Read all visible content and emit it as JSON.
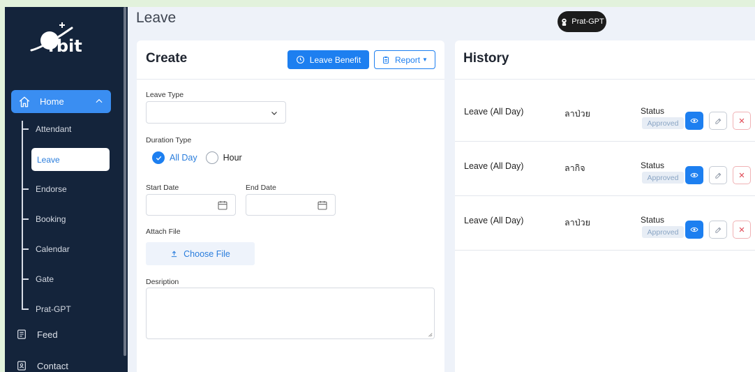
{
  "sidebar": {
    "brand": "rbit",
    "home_label": "Home",
    "sub_items": [
      {
        "label": "Attendant"
      },
      {
        "label": "Leave"
      },
      {
        "label": "Endorse"
      },
      {
        "label": "Booking"
      },
      {
        "label": "Calendar"
      },
      {
        "label": "Gate"
      },
      {
        "label": "Prat-GPT"
      }
    ],
    "feed_label": "Feed",
    "contact_label": "Contact"
  },
  "header": {
    "page_title": "Leave",
    "gpt_badge": "Prat-GPT"
  },
  "create": {
    "title": "Create",
    "benefit_button": "Leave Benefit",
    "report_button": "Report",
    "leave_type_label": "Leave Type",
    "duration_type_label": "Duration Type",
    "duration_options": [
      "All Day",
      "Hour"
    ],
    "duration_selected": "All Day",
    "start_date_label": "Start Date",
    "end_date_label": "End Date",
    "attach_label": "Attach File",
    "choose_file": "Choose File",
    "description_label": "Desription"
  },
  "history": {
    "title": "History",
    "rows": [
      {
        "type": "Leave (All Day)",
        "reason": "ลาป่วย",
        "status_label": "Status",
        "status": "Approved"
      },
      {
        "type": "Leave (All Day)",
        "reason": "ลากิจ",
        "status_label": "Status",
        "status": "Approved"
      },
      {
        "type": "Leave (All Day)",
        "reason": "ลาป่วย",
        "status_label": "Status",
        "status": "Approved"
      }
    ]
  },
  "colors": {
    "primary": "#1d7ff0",
    "sidebar_bg": "#14243b",
    "page_bg": "#eef2f9",
    "frame_bg": "#e2f2dc"
  }
}
